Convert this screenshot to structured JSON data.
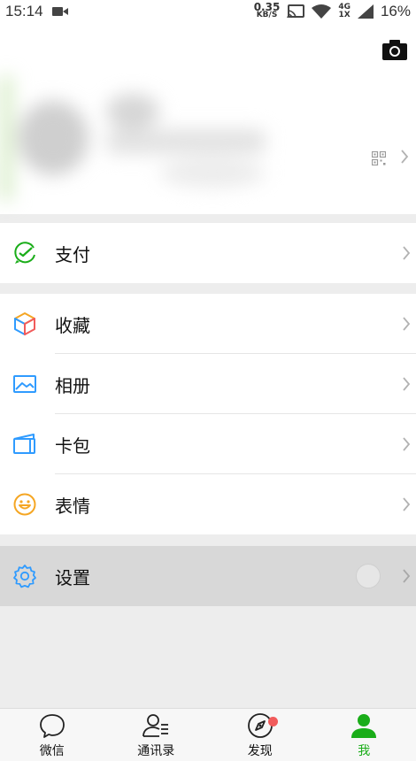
{
  "status_bar": {
    "time": "15:14",
    "net_speed_value": "0.35",
    "net_speed_unit": "KB/S",
    "network_type": "4G",
    "network_sub": "1X",
    "battery": "16%"
  },
  "menu": {
    "pay": "支付",
    "favorites": "收藏",
    "album": "相册",
    "cards": "卡包",
    "stickers": "表情",
    "settings": "设置"
  },
  "tabs": [
    {
      "label": "微信"
    },
    {
      "label": "通讯录"
    },
    {
      "label": "发现"
    },
    {
      "label": "我"
    }
  ],
  "colors": {
    "accent": "#1aad19",
    "badge": "#f15b5b"
  }
}
